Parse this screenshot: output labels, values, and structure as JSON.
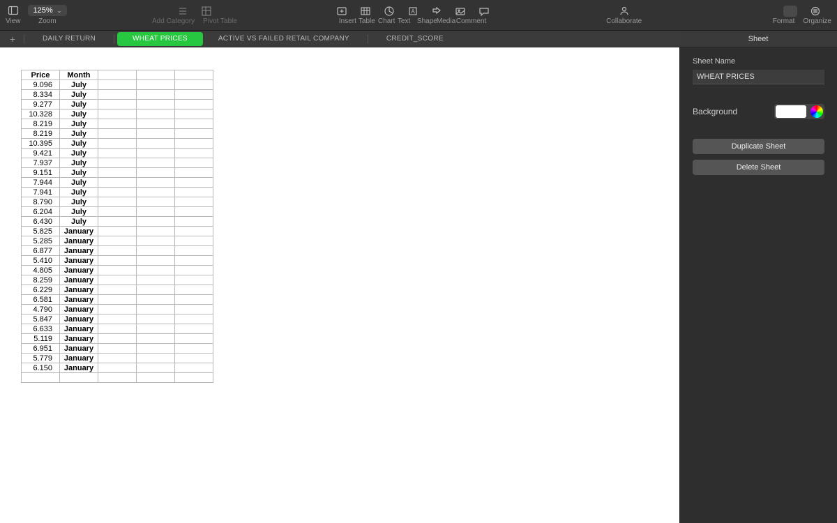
{
  "toolbar": {
    "view_label": "View",
    "zoom_value": "125%",
    "zoom_label": "Zoom",
    "add_category_label": "Add Category",
    "pivot_table_label": "Pivot Table",
    "insert_label": "Insert",
    "table_label": "Table",
    "chart_label": "Chart",
    "text_label": "Text",
    "shape_label": "Shape",
    "media_label": "Media",
    "comment_label": "Comment",
    "collaborate_label": "Collaborate",
    "format_label": "Format",
    "organize_label": "Organize"
  },
  "tabs": [
    {
      "label": "DAILY RETURN",
      "active": false
    },
    {
      "label": "WHEAT PRICES",
      "active": true
    },
    {
      "label": "ACTIVE VS FAILED RETAIL COMPANY",
      "active": false
    },
    {
      "label": "CREDIT_SCORE",
      "active": false
    }
  ],
  "sidebar": {
    "tab_label": "Sheet",
    "sheet_name_label": "Sheet Name",
    "sheet_name_value": "WHEAT PRICES",
    "background_label": "Background",
    "duplicate_label": "Duplicate Sheet",
    "delete_label": "Delete Sheet"
  },
  "table": {
    "headers": [
      "Price",
      "Month"
    ],
    "rows": [
      {
        "price": "9.096",
        "month": "July"
      },
      {
        "price": "8.334",
        "month": "July"
      },
      {
        "price": "9.277",
        "month": "July"
      },
      {
        "price": "10.328",
        "month": "July"
      },
      {
        "price": "8.219",
        "month": "July"
      },
      {
        "price": "8.219",
        "month": "July"
      },
      {
        "price": "10.395",
        "month": "July"
      },
      {
        "price": "9.421",
        "month": "July"
      },
      {
        "price": "7.937",
        "month": "July"
      },
      {
        "price": "9.151",
        "month": "July"
      },
      {
        "price": "7.944",
        "month": "July"
      },
      {
        "price": "7.941",
        "month": "July"
      },
      {
        "price": "8.790",
        "month": "July"
      },
      {
        "price": "6.204",
        "month": "July"
      },
      {
        "price": "6.430",
        "month": "July"
      },
      {
        "price": "5.825",
        "month": "January"
      },
      {
        "price": "5.285",
        "month": "January"
      },
      {
        "price": "6.877",
        "month": "January"
      },
      {
        "price": "5.410",
        "month": "January"
      },
      {
        "price": "4.805",
        "month": "January"
      },
      {
        "price": "8.259",
        "month": "January"
      },
      {
        "price": "6.229",
        "month": "January"
      },
      {
        "price": "6.581",
        "month": "January"
      },
      {
        "price": "4.790",
        "month": "January"
      },
      {
        "price": "5.847",
        "month": "January"
      },
      {
        "price": "6.633",
        "month": "January"
      },
      {
        "price": "5.119",
        "month": "January"
      },
      {
        "price": "6.951",
        "month": "January"
      },
      {
        "price": "5.779",
        "month": "January"
      },
      {
        "price": "6.150",
        "month": "January"
      }
    ]
  }
}
